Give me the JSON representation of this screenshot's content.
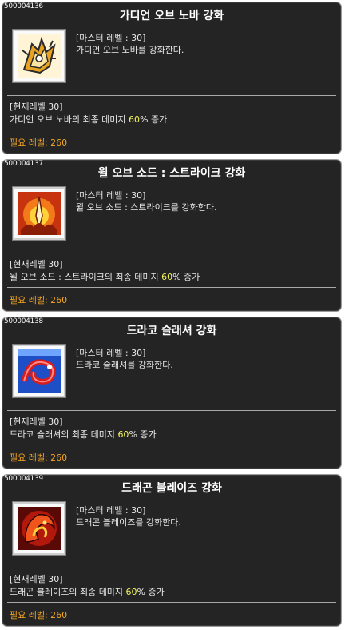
{
  "colors": {
    "panel_bg": "#242424",
    "panel_border": "#9a9a9a",
    "text": "#e8e8e8",
    "highlight_value": "#f3f35a",
    "required_level": "#f5a623"
  },
  "tooltips": [
    {
      "id": "500004136",
      "name": "가디언 오브 노바 강화",
      "icon": "guardian-of-nova-skill-icon",
      "master_level": "[마스터 레벨 : 30]",
      "description": "가디언 오브 노바를 강화한다.",
      "current_level": "[현재레벨 30]",
      "effect_pre": "가디언 오브 노바의 최종 데미지 ",
      "effect_value": "60",
      "effect_post": "% 증가",
      "required_level": "필요 레벨: 260"
    },
    {
      "id": "500004137",
      "name": "윌 오브 소드 : 스트라이크 강화",
      "icon": "will-of-sword-strike-skill-icon",
      "master_level": "[마스터 레벨 : 30]",
      "description": "윌 오브 소드 : 스트라이크를 강화한다.",
      "current_level": "[현재레벨 30]",
      "effect_pre": "윌 오브 소드 : 스트라이크의 최종 데미지 ",
      "effect_value": "60",
      "effect_post": "% 증가",
      "required_level": "필요 레벨: 260"
    },
    {
      "id": "500004138",
      "name": "드라코 슬래셔 강화",
      "icon": "draco-slasher-skill-icon",
      "master_level": "[마스터 레벨 : 30]",
      "description": "드라코 슬래셔를 강화한다.",
      "current_level": "[현재레벨 30]",
      "effect_pre": "드라코 슬래셔의 최종 데미지 ",
      "effect_value": "60",
      "effect_post": "% 증가",
      "required_level": "필요 레벨: 260"
    },
    {
      "id": "500004139",
      "name": "드래곤 블레이즈 강화",
      "icon": "dragon-blaze-skill-icon",
      "master_level": "[마스터 레벨 : 30]",
      "description": "드래곤 블레이즈를 강화한다.",
      "current_level": "[현재레벨 30]",
      "effect_pre": "드래곤 블레이즈의 최종 데미지 ",
      "effect_value": "60",
      "effect_post": "% 증가",
      "required_level": "필요 레벨: 260"
    }
  ]
}
